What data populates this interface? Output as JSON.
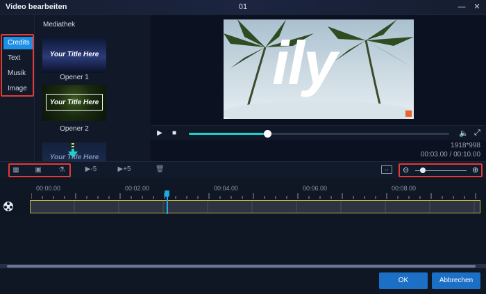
{
  "window": {
    "title": "Video bearbeiten",
    "doc_index": "01"
  },
  "categories": [
    {
      "label": "Credits",
      "active": true
    },
    {
      "label": "Text",
      "active": false
    },
    {
      "label": "Musik",
      "active": false
    },
    {
      "label": "Image",
      "active": false
    }
  ],
  "library": {
    "heading": "Mediathek",
    "items": [
      {
        "thumb_text": "Your Title Here",
        "caption": "Opener 1"
      },
      {
        "thumb_text": "Your Title Here",
        "caption": "Opener 2"
      },
      {
        "thumb_text": "Your Title Here",
        "caption": ""
      }
    ]
  },
  "preview": {
    "overlay_text": "ily",
    "progress": 0.3,
    "resolution": "1918*998",
    "timecode": "00:03.00 / 00:10.00"
  },
  "toolbar": {
    "skip_back_label": "▶-5",
    "skip_fwd_label": "▶+5",
    "zoom_level": 0.1
  },
  "timeline": {
    "ticks": [
      "00:00.00",
      "00:02.00",
      "00:04.00",
      "00:06.00",
      "00:08.00"
    ]
  },
  "footer": {
    "ok_label": "OK",
    "cancel_label": "Abbrechen"
  },
  "colors": {
    "accent": "#1b6fc4",
    "highlight": "#e23b35",
    "progress": "#1ed1c8"
  }
}
